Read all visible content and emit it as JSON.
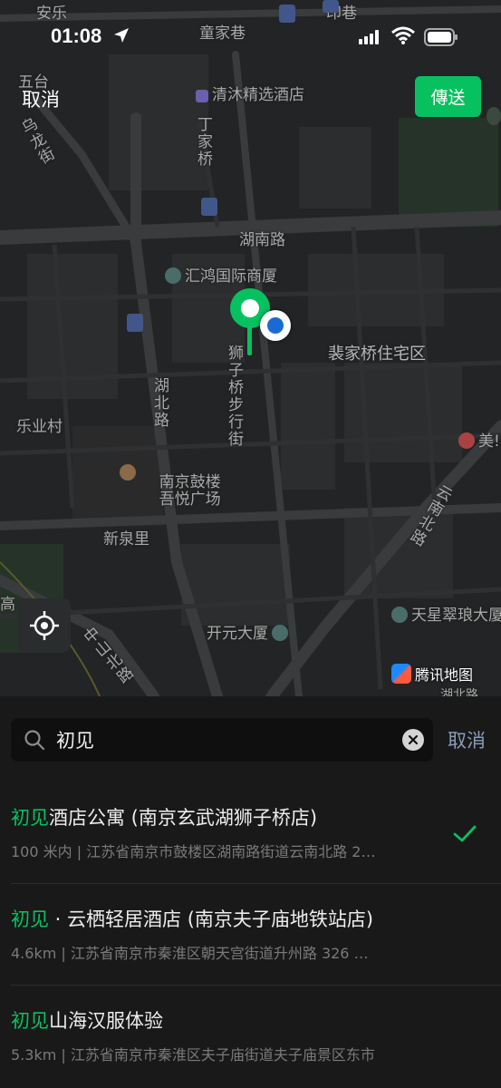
{
  "status": {
    "time": "01:08"
  },
  "header": {
    "cancel_label": "取消",
    "send_label": "傳送"
  },
  "map": {
    "labels": {
      "anle": "安乐",
      "tongjiaxiang": "童家巷",
      "yinxiang": "印巷",
      "qingmu_hotel": "清沐精选酒店",
      "wutai": "五台",
      "wutaishan_road": "乌龙街",
      "dingjiaqiao": "丁家桥",
      "hunan_road": "湖南路",
      "huihong": "汇鸿国际商厦",
      "shizi_street": "狮子桥步行街",
      "peijiaqiao": "裴家桥住宅区",
      "hubei_road": "湖北路",
      "leye_village": "乐业村",
      "gulou_mall": "南京鼓楼\n吾悦广场",
      "yunnan_north": "云南北路",
      "xinquanli": "新泉里",
      "gao": "高",
      "zhongshan_north": "中山北路",
      "kaiyuan": "开元大厦",
      "tianxing": "天星翠琅大厦",
      "meinian": "美!",
      "hubei_bottom": "湖北路"
    },
    "brand": "腾讯地图"
  },
  "search": {
    "query": "初见",
    "cancel_label": "取消"
  },
  "results": [
    {
      "highlight": "初见",
      "rest": "酒店公寓 (南京玄武湖狮子桥店)",
      "subtitle": "100 米内 | 江苏省南京市鼓楼区湖南路街道云南北路 2…",
      "selected": true
    },
    {
      "highlight": "初见",
      "rest": " · 云栖轻居酒店 (南京夫子庙地铁站店)",
      "subtitle": "4.6km | 江苏省南京市秦淮区朝天宫街道升州路 326 …",
      "selected": false
    },
    {
      "highlight": "初见",
      "rest": "山海汉服体验",
      "subtitle": "5.3km | 江苏省南京市秦淮区夫子庙街道夫子庙景区东市",
      "selected": false
    }
  ],
  "colors": {
    "accent": "#07c160",
    "link": "#8a9db5",
    "map_bg": "#232425"
  }
}
